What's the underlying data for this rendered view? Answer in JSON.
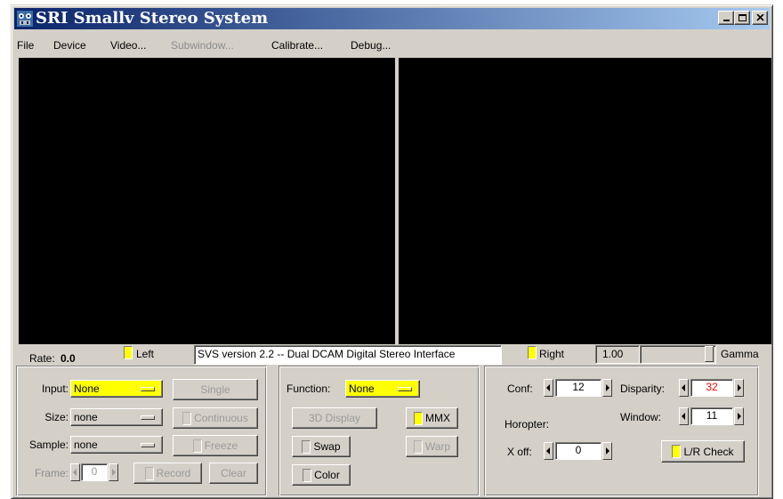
{
  "window": {
    "title": "SRI Smallv Stereo System",
    "minimize_glyph": "_",
    "maximize_glyph": "□",
    "close_glyph": "✕"
  },
  "menu": [
    {
      "label": "File",
      "enabled": true
    },
    {
      "label": "Device",
      "enabled": true
    },
    {
      "label": "Video...",
      "enabled": true
    },
    {
      "label": "Subwindow...",
      "enabled": false
    },
    {
      "label": "Calibrate...",
      "enabled": true
    },
    {
      "label": "Debug...",
      "enabled": true
    }
  ],
  "status": {
    "rate_label": "Rate:",
    "rate_value": "0.0",
    "left_label": "Left",
    "version_text": "SVS version 2.2 -- Dual DCAM Digital Stereo Interface",
    "right_label": "Right",
    "gamma_value": "1.00",
    "gamma_label": "Gamma"
  },
  "input_panel": {
    "input_label": "Input:",
    "input_value": "None",
    "size_label": "Size:",
    "size_value": "none",
    "sample_label": "Sample:",
    "sample_value": "none",
    "frame_label": "Frame:",
    "frame_value": "0",
    "single_label": "Single",
    "continuous_label": "Continuous",
    "freeze_label": "Freeze",
    "record_label": "Record",
    "clear_label": "Clear"
  },
  "function_panel": {
    "function_label": "Function:",
    "function_value": "None",
    "display3d_label": "3D Display",
    "mmx_label": "MMX",
    "swap_label": "Swap",
    "warp_label": "Warp",
    "color_label": "Color"
  },
  "stereo_panel": {
    "conf_label": "Conf:",
    "conf_value": "12",
    "disparity_label": "Disparity:",
    "disparity_value": "32",
    "horopter_label": "Horopter:",
    "window_label": "Window:",
    "window_value": "11",
    "xoff_label": "X off:",
    "xoff_value": "0",
    "lrcheck_label": "L/R Check"
  },
  "colors": {
    "title_gradient_start": "#0a246a",
    "title_gradient_end": "#a6caf0",
    "indicator_on": "#ffff00",
    "disparity_text": "#ff0000",
    "face": "#d4d0c8"
  }
}
